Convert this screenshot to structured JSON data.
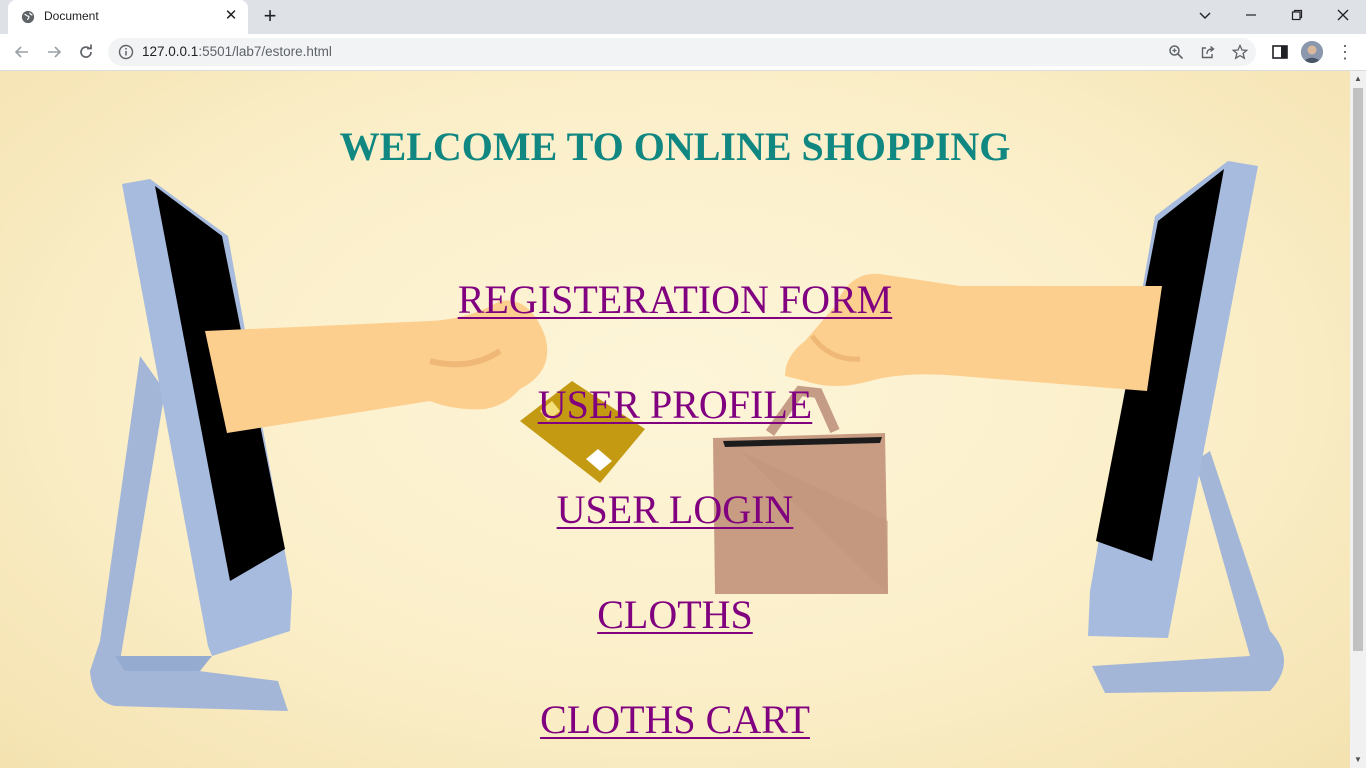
{
  "browser": {
    "tab_title": "Document",
    "url_host": "127.0.0.1",
    "url_rest": ":5501/lab7/estore.html",
    "window_controls": [
      "chevron-down-icon",
      "minimize-icon",
      "restore-icon",
      "close-icon"
    ]
  },
  "page": {
    "heading": "WELCOME TO ONLINE SHOPPING",
    "links": [
      {
        "label": "REGISTERATION FORM"
      },
      {
        "label": "USER PROFILE"
      },
      {
        "label": "USER LOGIN"
      },
      {
        "label": "CLOTHS"
      },
      {
        "label": "CLOTHS CART"
      }
    ]
  },
  "colors": {
    "heading": "#118782",
    "link": "#800080",
    "background": "#fbefc9",
    "monitor_frame": "#a3b6d8",
    "skin": "#fccf8f",
    "bag": "#c79c83",
    "card": "#c49a12"
  }
}
